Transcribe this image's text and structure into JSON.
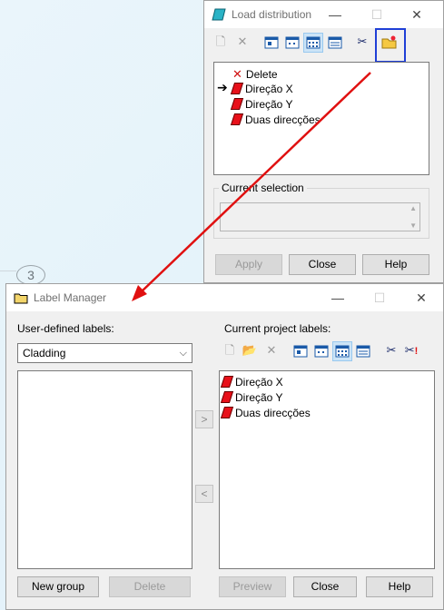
{
  "background": {
    "marker": "3"
  },
  "load_distribution": {
    "title": "Load distribution",
    "icon": "eraser-icon",
    "toolbar": [
      "new-doc-icon",
      "delete-x-icon",
      "view-large-icon",
      "view-small-icon",
      "view-grid-icon",
      "view-details-icon",
      "cut-icon",
      "open-folder-icon"
    ],
    "items": [
      {
        "label": "Delete",
        "icon": "red-x-icon"
      },
      {
        "label": "Direção X",
        "icon": "red-tag-icon",
        "current": true
      },
      {
        "label": "Direção Y",
        "icon": "red-tag-icon"
      },
      {
        "label": "Duas direcções",
        "icon": "red-tag-icon"
      }
    ],
    "current_selection_label": "Current selection",
    "current_selection_value": "",
    "apply": "Apply",
    "close": "Close",
    "help": "Help"
  },
  "label_manager": {
    "title": "Label Manager",
    "user_defined_label": "User-defined labels:",
    "group_selected": "Cladding",
    "current_project_label": "Current project labels:",
    "project_items": [
      "Direção X",
      "Direção Y",
      "Duas direcções"
    ],
    "move_right": ">",
    "move_left": "<",
    "new_group": "New group",
    "delete": "Delete",
    "preview": "Preview",
    "close": "Close",
    "help": "Help"
  },
  "colors": {
    "annotation_arrow": "#e01010",
    "highlight_box": "#1f3fd6",
    "tag": "#e8101a"
  }
}
